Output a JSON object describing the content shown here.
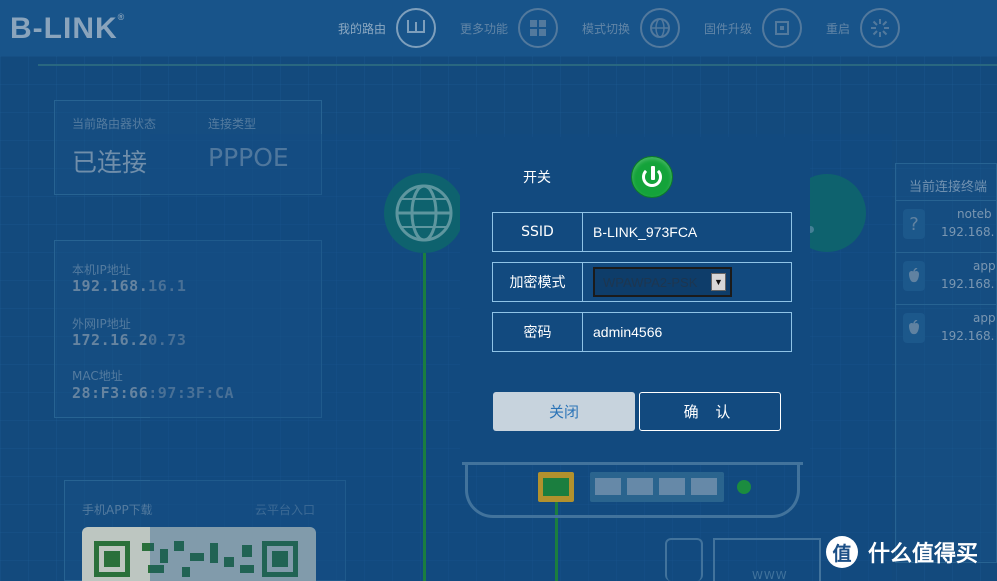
{
  "header": {
    "logo": "B-LINK",
    "logo_mark": "®",
    "nav": [
      {
        "label": "我的路由",
        "icon": "router-icon"
      },
      {
        "label": "更多功能",
        "icon": "grid-icon"
      },
      {
        "label": "模式切换",
        "icon": "globe-icon"
      },
      {
        "label": "固件升级",
        "icon": "chip-icon"
      },
      {
        "label": "重启",
        "icon": "restart-icon"
      }
    ]
  },
  "status_panel": {
    "router_status_label": "当前路由器状态",
    "router_status_value": "已连接",
    "connection_type_label": "连接类型",
    "connection_type_value": "PPPOE"
  },
  "info_panel": {
    "local_ip_label": "本机IP地址",
    "local_ip_value": "192.168.16.1",
    "wan_ip_label": "外网IP地址",
    "wan_ip_value": "172.16.20.73",
    "mac_label": "MAC地址",
    "mac_value": "28:F3:66:97:3F:CA"
  },
  "app_panel": {
    "download_label": "手机APP下载",
    "cloud_label": "云平台入口"
  },
  "terminals": {
    "title": "当前连接终端",
    "items": [
      {
        "name": "noteb",
        "ip": "192.168.",
        "icon": "question-icon"
      },
      {
        "name": "app",
        "ip": "192.168.",
        "icon": "apple-icon"
      },
      {
        "name": "app",
        "ip": "192.168.",
        "icon": "apple-icon"
      }
    ]
  },
  "diagram": {
    "www_label": "WWW"
  },
  "dialog": {
    "switch_label": "开关",
    "switch_state": "on",
    "ssid_label": "SSID",
    "ssid_value": "B-LINK_973FCA",
    "encryption_label": "加密模式",
    "encryption_value": "WPAWPA2-PSK",
    "password_label": "密码",
    "password_value": "admin4566",
    "close_button": "关闭",
    "confirm_button": "确 认"
  },
  "watermark": {
    "icon_text": "值",
    "text": "什么值得买"
  },
  "colors": {
    "background": "#154f85",
    "dialog": "#124a7f",
    "power_on": "#14a33a",
    "field_border": "#8fc3e6",
    "close_button_bg": "#c7d3dd",
    "close_button_text": "#2b74b7"
  }
}
